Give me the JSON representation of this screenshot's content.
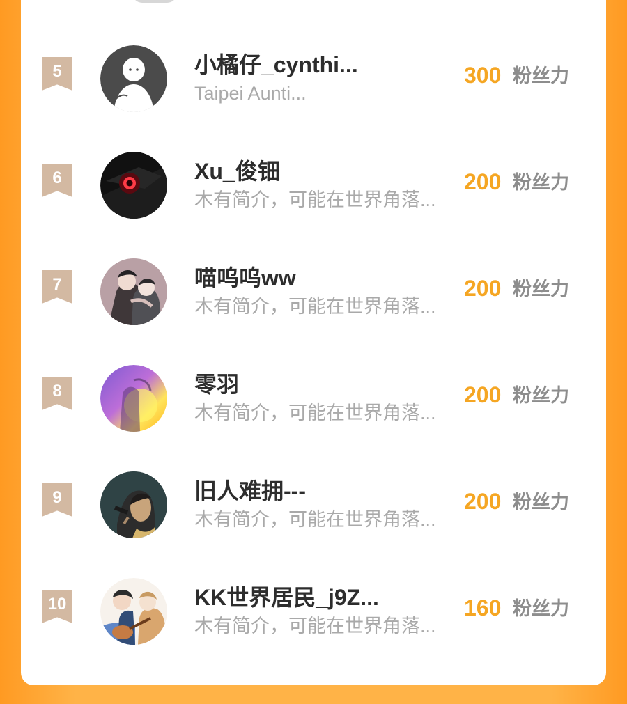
{
  "rows": [
    {
      "rank": "5",
      "name": "小橘仔_cynthi...",
      "bio": "Taipei Aunti...",
      "score": "300",
      "unit": "粉丝力",
      "avatar_icon": "default-user-avatar-icon",
      "avatar_colors": [
        "#4b4b4b",
        "#ffffff"
      ]
    },
    {
      "rank": "6",
      "name": "Xu_俊钿",
      "bio": "木有简介，可能在世界角落...",
      "score": "200",
      "unit": "粉丝力",
      "avatar_icon": "red-eye-avatar-icon",
      "avatar_colors": [
        "#111111",
        "#ff3b46"
      ]
    },
    {
      "rank": "7",
      "name": "喵呜呜ww",
      "bio": "木有简介，可能在世界角落...",
      "score": "200",
      "unit": "粉丝力",
      "avatar_icon": "two-people-illustration-avatar-icon",
      "avatar_colors": [
        "#7b6f73",
        "#f1e5df"
      ]
    },
    {
      "rank": "8",
      "name": "零羽",
      "bio": "木有简介，可能在世界角落...",
      "score": "200",
      "unit": "粉丝力",
      "avatar_icon": "purple-yellow-light-avatar-icon",
      "avatar_colors": [
        "#7b4fd8",
        "#ffd84b"
      ]
    },
    {
      "rank": "9",
      "name": "旧人难拥---",
      "bio": "木有简介，可能在世界角落...",
      "score": "200",
      "unit": "粉丝力",
      "avatar_icon": "girl-portrait-avatar-icon",
      "avatar_colors": [
        "#2f4345",
        "#c8a47b"
      ]
    },
    {
      "rank": "10",
      "name": "KK世界居民_j9Z...",
      "bio": "木有简介，可能在世界角落...",
      "score": "160",
      "unit": "粉丝力",
      "avatar_icon": "guitar-couple-illustration-avatar-icon",
      "avatar_colors": [
        "#5c7fbf",
        "#f3ddc7"
      ]
    }
  ],
  "colors": {
    "background_orange": "#ffb347",
    "rank_badge": "#d3b9a2",
    "score_orange": "#f5a623",
    "name_text": "#2d2d2d",
    "bio_text": "#a9a9a9",
    "unit_text": "#8d8d8d"
  }
}
